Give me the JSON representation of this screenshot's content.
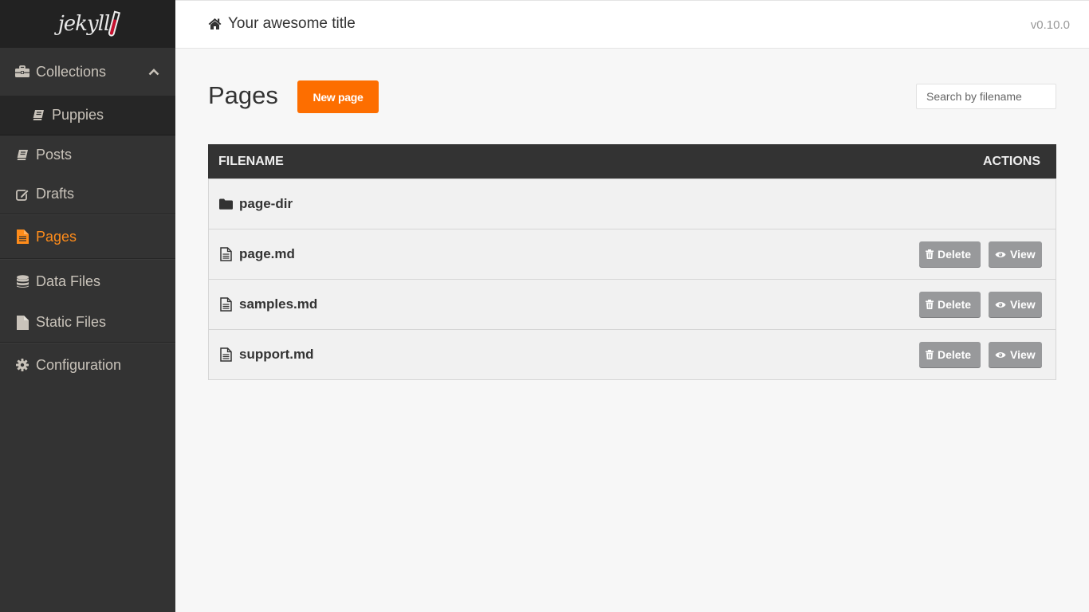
{
  "sidebar": {
    "logo": "jekyll",
    "items": [
      {
        "label": "Collections",
        "icon": "briefcase-icon",
        "expanded": true
      },
      {
        "label": "Puppies",
        "icon": "book-icon"
      },
      {
        "label": "Posts",
        "icon": "book-icon"
      },
      {
        "label": "Drafts",
        "icon": "edit-icon"
      },
      {
        "label": "Pages",
        "icon": "file-text-icon",
        "active": true
      },
      {
        "label": "Data Files",
        "icon": "database-icon"
      },
      {
        "label": "Static Files",
        "icon": "file-icon"
      },
      {
        "label": "Configuration",
        "icon": "gear-icon"
      }
    ],
    "active_color": "#ff8c1a"
  },
  "header": {
    "title": "Your awesome title",
    "version": "v0.10.0"
  },
  "main": {
    "page_title": "Pages",
    "new_button": "New page",
    "search_placeholder": "Search by filename",
    "accent_color": "#fd6e00",
    "table": {
      "columns": [
        "FILENAME",
        "ACTIONS"
      ],
      "rows": [
        {
          "name": "page-dir",
          "type": "directory"
        },
        {
          "name": "page.md",
          "type": "file"
        },
        {
          "name": "samples.md",
          "type": "file"
        },
        {
          "name": "support.md",
          "type": "file"
        }
      ],
      "delete_label": "Delete",
      "view_label": "View"
    }
  }
}
